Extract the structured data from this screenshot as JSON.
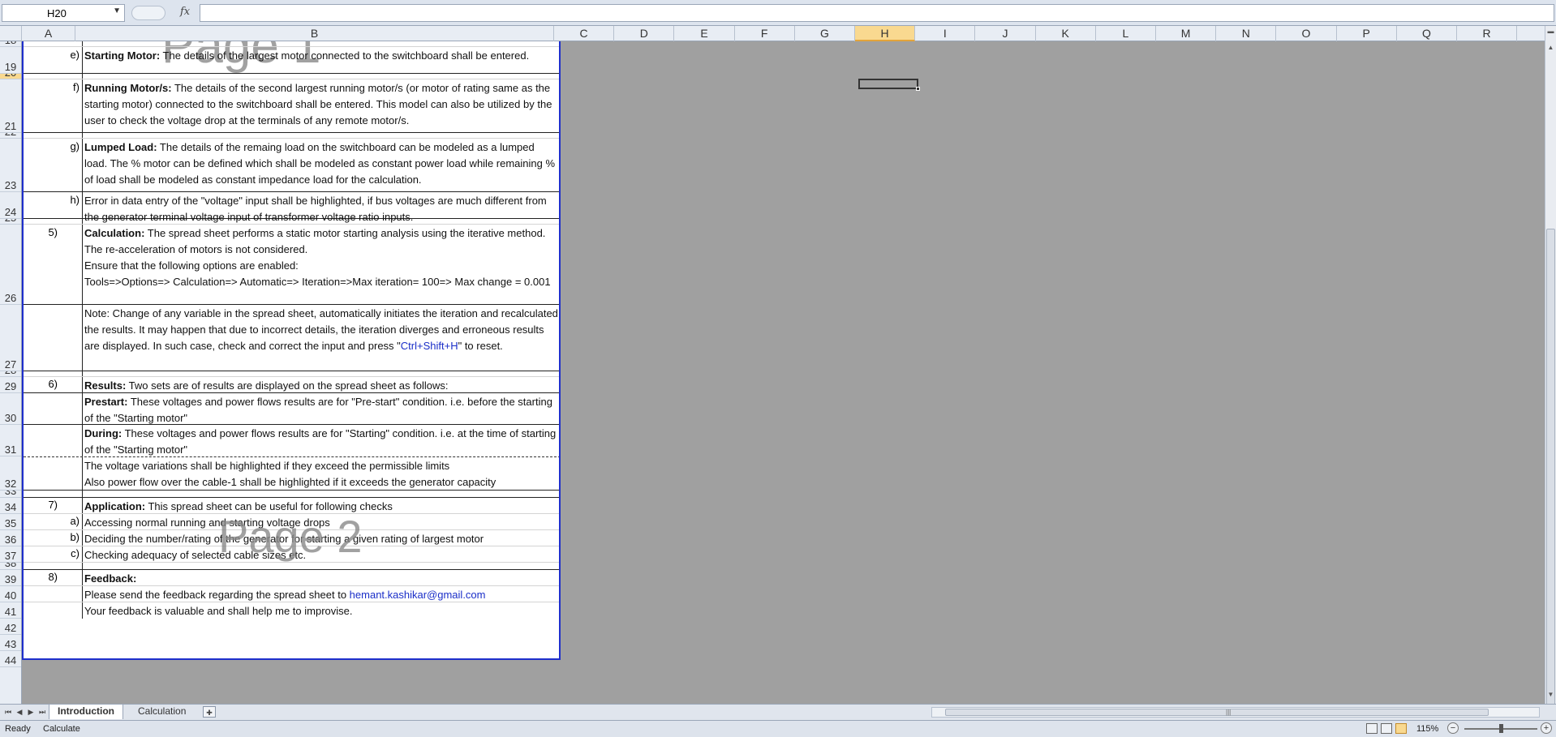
{
  "formula_bar": {
    "name_box": "H20",
    "fx_label": "fx",
    "formula": ""
  },
  "columns": [
    "A",
    "B",
    "C",
    "D",
    "E",
    "F",
    "G",
    "H",
    "I",
    "J",
    "K",
    "L",
    "M",
    "N",
    "O",
    "P",
    "Q",
    "R"
  ],
  "selected_column": "H",
  "rows": [
    "18",
    "19",
    "20",
    "21",
    "22",
    "23",
    "24",
    "25",
    "26",
    "27",
    "28",
    "29",
    "30",
    "31",
    "32",
    "33",
    "34",
    "35",
    "36",
    "37",
    "38",
    "39",
    "40",
    "41",
    "42",
    "43",
    "44"
  ],
  "selected_row": "20",
  "watermarks": {
    "page1": "Page 1",
    "page2": "Page 2"
  },
  "content": {
    "r19": {
      "num": "e)",
      "bold": "Starting Motor:",
      "text": " The details of the largest motor connected to the switchboard shall be entered."
    },
    "r21": {
      "num": "f)",
      "bold": "Running Motor/s:",
      "text": " The details of the second largest running motor/s (or motor of rating same as the starting motor) connected to the switchboard shall be entered. This model can also be utilized by the user to check the voltage drop at the terminals of any remote motor/s."
    },
    "r23": {
      "num": "g)",
      "bold": "Lumped Load:",
      "text": " The details of the remaing load on the switchboard can be modeled as a lumped load. The % motor can be defined which shall be modeled as constant power load while remaining % of load shall be modeled as constant impedance load for the calculation."
    },
    "r24": {
      "num": "h)",
      "text": "Error in data entry of the \"voltage\" input shall be highlighted, if bus voltages are much different from the generator terminal voltage input of transformer voltage ratio inputs."
    },
    "r26": {
      "num": "5)",
      "bold": "Calculation:",
      "text": " The spread sheet performs a static motor starting analysis using the iterative method. The re-acceleration of motors is not considered.",
      "line2": "Ensure that the following options are enabled:",
      "line3": "Tools=>Options=> Calculation=> Automatic=> Iteration=>Max iteration= 100=> Max change = 0.001"
    },
    "r27": {
      "text": "Note: Change of any variable in the spread sheet, automatically initiates the iteration and recalculated the results. It may happen that due to incorrect details, the iteration diverges and erroneous results are displayed. In such case, check and correct the input and press \"",
      "link": "Ctrl+Shift+H",
      "tail": "\" to reset."
    },
    "r29": {
      "num": "6)",
      "bold": "Results:",
      "text": " Two sets are of results are displayed on the spread sheet as follows:"
    },
    "r30": {
      "bold": "Prestart:",
      "text": " These voltages and power flows results are for \"Pre-start\" condition. i.e. before the starting of the \"Starting motor\""
    },
    "r31": {
      "bold": "During:",
      "text": " These voltages and power flows results are for \"Starting\" condition. i.e. at the time of starting of the \"Starting motor\""
    },
    "r32": {
      "line1": "The voltage variations shall be highlighted if they exceed the permissible limits",
      "line2": "Also power flow over the cable-1 shall be highlighted if it exceeds the generator capacity"
    },
    "r34": {
      "num": "7)",
      "bold": "Application:",
      "text": " This spread sheet can be useful for following checks"
    },
    "r35": {
      "num": "a)",
      "text": "Accessing normal running and starting voltage drops"
    },
    "r36": {
      "num": "b)",
      "text": "Deciding the number/rating of the generator for starting a given rating of largest motor"
    },
    "r37": {
      "num": "c)",
      "text": "Checking adequacy of selected cable sizes etc."
    },
    "r39": {
      "num": "8)",
      "bold": "Feedback:"
    },
    "r40": {
      "text": "Please send the feedback regarding the spread sheet to ",
      "link": "hemant.kashikar@gmail.com"
    },
    "r41": {
      "text": "Your feedback is valuable and shall help me to improvise."
    }
  },
  "tabs": [
    "Introduction",
    "Calculation"
  ],
  "active_tab": "Introduction",
  "status": {
    "ready": "Ready",
    "calculate": "Calculate",
    "zoom": "115%"
  }
}
